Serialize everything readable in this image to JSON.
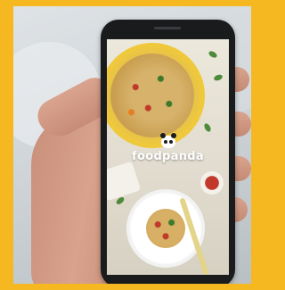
{
  "brand": {
    "name": "foodpanda",
    "icon": "panda-icon"
  },
  "colors": {
    "frame": "#f5b820",
    "phone_body": "#1a1b1d",
    "brand_text": "#ffffff"
  }
}
